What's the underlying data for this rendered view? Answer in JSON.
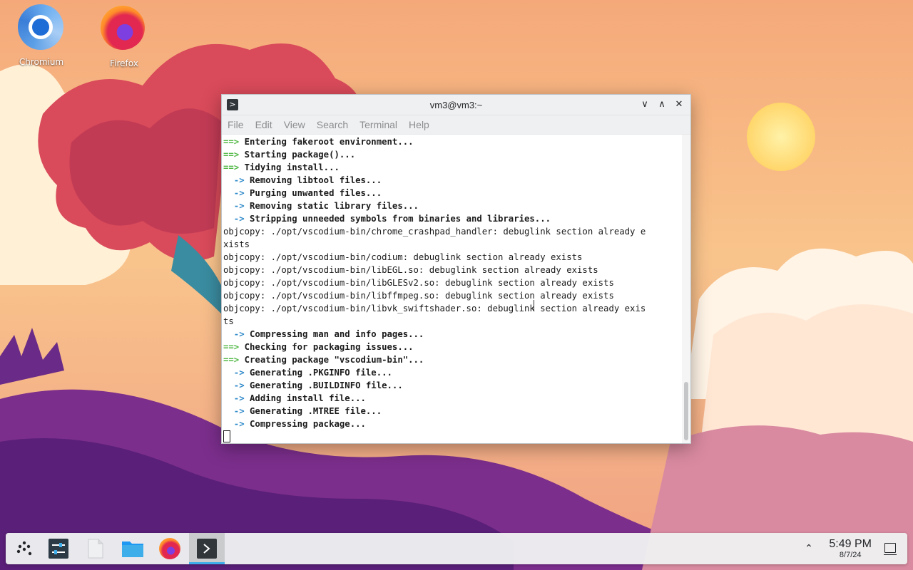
{
  "desktop": {
    "icons": [
      {
        "label": "Chromium",
        "icon": "chromium-icon"
      },
      {
        "label": "Firefox",
        "icon": "firefox-icon"
      }
    ]
  },
  "window": {
    "title": "vm3@vm3:~",
    "app_icon": ">",
    "buttons": {
      "minimize": "∨",
      "maximize": "∧",
      "close": "✕"
    },
    "menu": [
      "File",
      "Edit",
      "View",
      "Search",
      "Terminal",
      "Help"
    ]
  },
  "terminal": {
    "lines": [
      {
        "prefix": "==>",
        "kind": "eq",
        "text": " Entering fakeroot environment..."
      },
      {
        "prefix": "==>",
        "kind": "eq",
        "text": " Starting package()..."
      },
      {
        "prefix": "==>",
        "kind": "eq",
        "text": " Tidying install..."
      },
      {
        "prefix": "  ->",
        "kind": "dash",
        "text": " Removing libtool files..."
      },
      {
        "prefix": "  ->",
        "kind": "dash",
        "text": " Purging unwanted files..."
      },
      {
        "prefix": "  ->",
        "kind": "dash",
        "text": " Removing static library files..."
      },
      {
        "prefix": "  ->",
        "kind": "dash",
        "text": " Stripping unneeded symbols from binaries and libraries..."
      },
      {
        "prefix": "",
        "kind": "plain",
        "text": "objcopy: ./opt/vscodium-bin/chrome_crashpad_handler: debuglink section already e"
      },
      {
        "prefix": "",
        "kind": "plain",
        "text": "xists"
      },
      {
        "prefix": "",
        "kind": "plain",
        "text": "objcopy: ./opt/vscodium-bin/codium: debuglink section already exists"
      },
      {
        "prefix": "",
        "kind": "plain",
        "text": "objcopy: ./opt/vscodium-bin/libEGL.so: debuglink section already exists"
      },
      {
        "prefix": "",
        "kind": "plain",
        "text": "objcopy: ./opt/vscodium-bin/libGLESv2.so: debuglink section already exists"
      },
      {
        "prefix": "",
        "kind": "plain",
        "text": "objcopy: ./opt/vscodium-bin/libffmpeg.so: debuglink section already exists"
      },
      {
        "prefix": "",
        "kind": "plain",
        "text": "objcopy: ./opt/vscodium-bin/libvk_swiftshader.so: debuglink section already exis"
      },
      {
        "prefix": "",
        "kind": "plain",
        "text": "ts"
      },
      {
        "prefix": "  ->",
        "kind": "dash",
        "text": " Compressing man and info pages..."
      },
      {
        "prefix": "==>",
        "kind": "eq",
        "text": " Checking for packaging issues..."
      },
      {
        "prefix": "==>",
        "kind": "eq",
        "text": " Creating package \"vscodium-bin\"..."
      },
      {
        "prefix": "  ->",
        "kind": "dash",
        "text": " Generating .PKGINFO file..."
      },
      {
        "prefix": "  ->",
        "kind": "dash",
        "text": " Generating .BUILDINFO file..."
      },
      {
        "prefix": "  ->",
        "kind": "dash",
        "text": " Adding install file..."
      },
      {
        "prefix": "  ->",
        "kind": "dash",
        "text": " Generating .MTREE file..."
      },
      {
        "prefix": "  ->",
        "kind": "dash",
        "text": " Compressing package..."
      }
    ]
  },
  "taskbar": {
    "items": [
      {
        "name": "application-launcher-icon"
      },
      {
        "name": "system-settings-icon"
      },
      {
        "name": "text-editor-icon"
      },
      {
        "name": "file-manager-icon"
      },
      {
        "name": "firefox-icon"
      },
      {
        "name": "terminal-icon",
        "active": true
      }
    ],
    "tray_arrow": "⌃",
    "clock": {
      "time": "5:49 PM",
      "date": "8/7/24"
    }
  },
  "colors": {
    "accent": "#3daee9",
    "prompt_eq": "#54b948",
    "prompt_dash": "#2e89c9"
  }
}
